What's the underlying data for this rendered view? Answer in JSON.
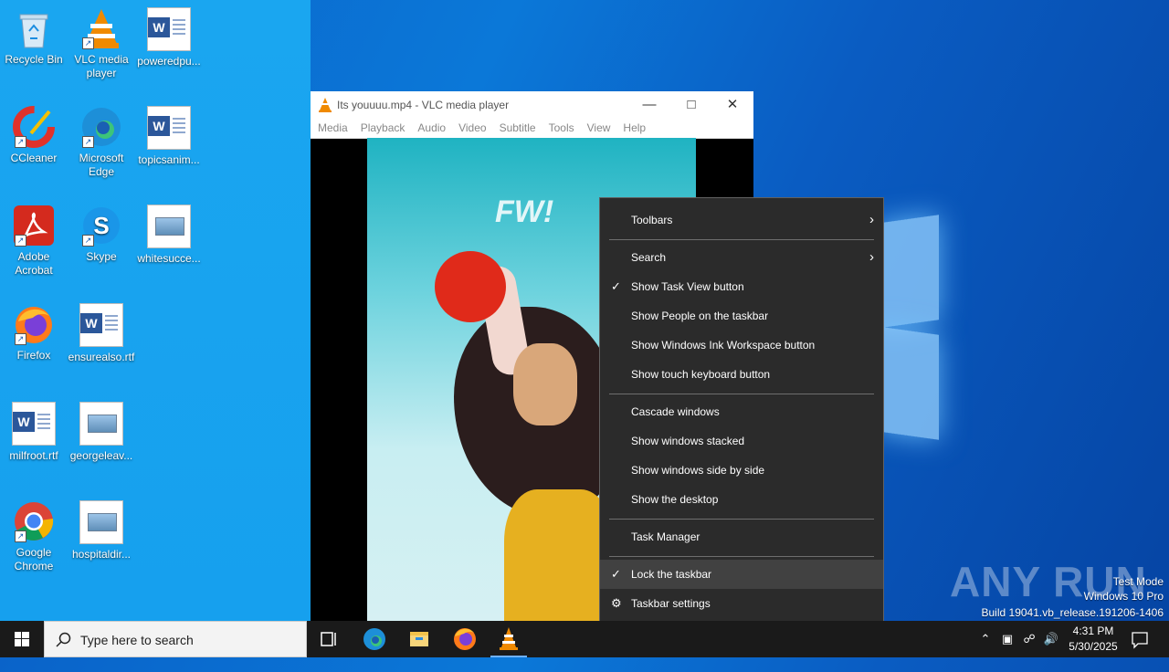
{
  "desktop": {
    "icons": [
      {
        "label": "Recycle Bin",
        "icon": "recycle-bin-icon"
      },
      {
        "label": "VLC media player",
        "icon": "vlc-icon"
      },
      {
        "label": "poweredpu...",
        "icon": "word-doc-icon"
      },
      {
        "label": "CCleaner",
        "icon": "ccleaner-icon"
      },
      {
        "label": "Microsoft Edge",
        "icon": "edge-icon"
      },
      {
        "label": "topicsanim...",
        "icon": "word-doc-icon"
      },
      {
        "label": "Adobe Acrobat",
        "icon": "acrobat-icon"
      },
      {
        "label": "Skype",
        "icon": "skype-icon"
      },
      {
        "label": "whitesucce...",
        "icon": "image-file-icon"
      },
      {
        "label": "Firefox",
        "icon": "firefox-icon"
      },
      {
        "label": "ensurealso.rtf",
        "icon": "word-doc-icon"
      },
      {
        "label": "milfroot.rtf",
        "icon": "word-doc-icon"
      },
      {
        "label": "georgeleav...",
        "icon": "image-file-icon"
      },
      {
        "label": "Google Chrome",
        "icon": "chrome-icon"
      },
      {
        "label": "hospitaldir...",
        "icon": "image-file-icon"
      }
    ]
  },
  "vlc": {
    "title": "Its youuuu.mp4 - VLC media player",
    "menu": [
      "Media",
      "Playback",
      "Audio",
      "Video",
      "Subtitle",
      "Tools",
      "View",
      "Help"
    ],
    "video_overlay_text": "FW!"
  },
  "context_menu": {
    "items": [
      {
        "label": "Toolbars",
        "submenu": true
      },
      {
        "label": "Search",
        "submenu": true
      },
      {
        "label": "Show Task View button",
        "checked": true
      },
      {
        "label": "Show People on the taskbar"
      },
      {
        "label": "Show Windows Ink Workspace button"
      },
      {
        "label": "Show touch keyboard button"
      },
      {
        "label": "Cascade windows"
      },
      {
        "label": "Show windows stacked"
      },
      {
        "label": "Show windows side by side"
      },
      {
        "label": "Show the desktop"
      },
      {
        "label": "Task Manager"
      },
      {
        "label": "Lock the taskbar",
        "checked": true,
        "highlighted": true
      },
      {
        "label": "Taskbar settings",
        "icon": "gear-icon"
      }
    ]
  },
  "watermark": {
    "logo": "ANY RUN",
    "mode": "Test Mode",
    "edition": "Windows 10 Pro",
    "build": "Build 19041.vb_release.191206-1406"
  },
  "taskbar": {
    "search_placeholder": "Type here to search",
    "apps": [
      "task-view-icon",
      "edge-icon",
      "file-explorer-icon",
      "firefox-icon",
      "vlc-icon"
    ],
    "clock_time": "4:31 PM",
    "clock_date": "5/30/2025"
  },
  "colors": {
    "desktop_blue": "#0a63c9",
    "menu_bg": "#2b2b2b",
    "taskbar_bg": "#1a1a1a",
    "vlc_orange": "#f08a00"
  }
}
